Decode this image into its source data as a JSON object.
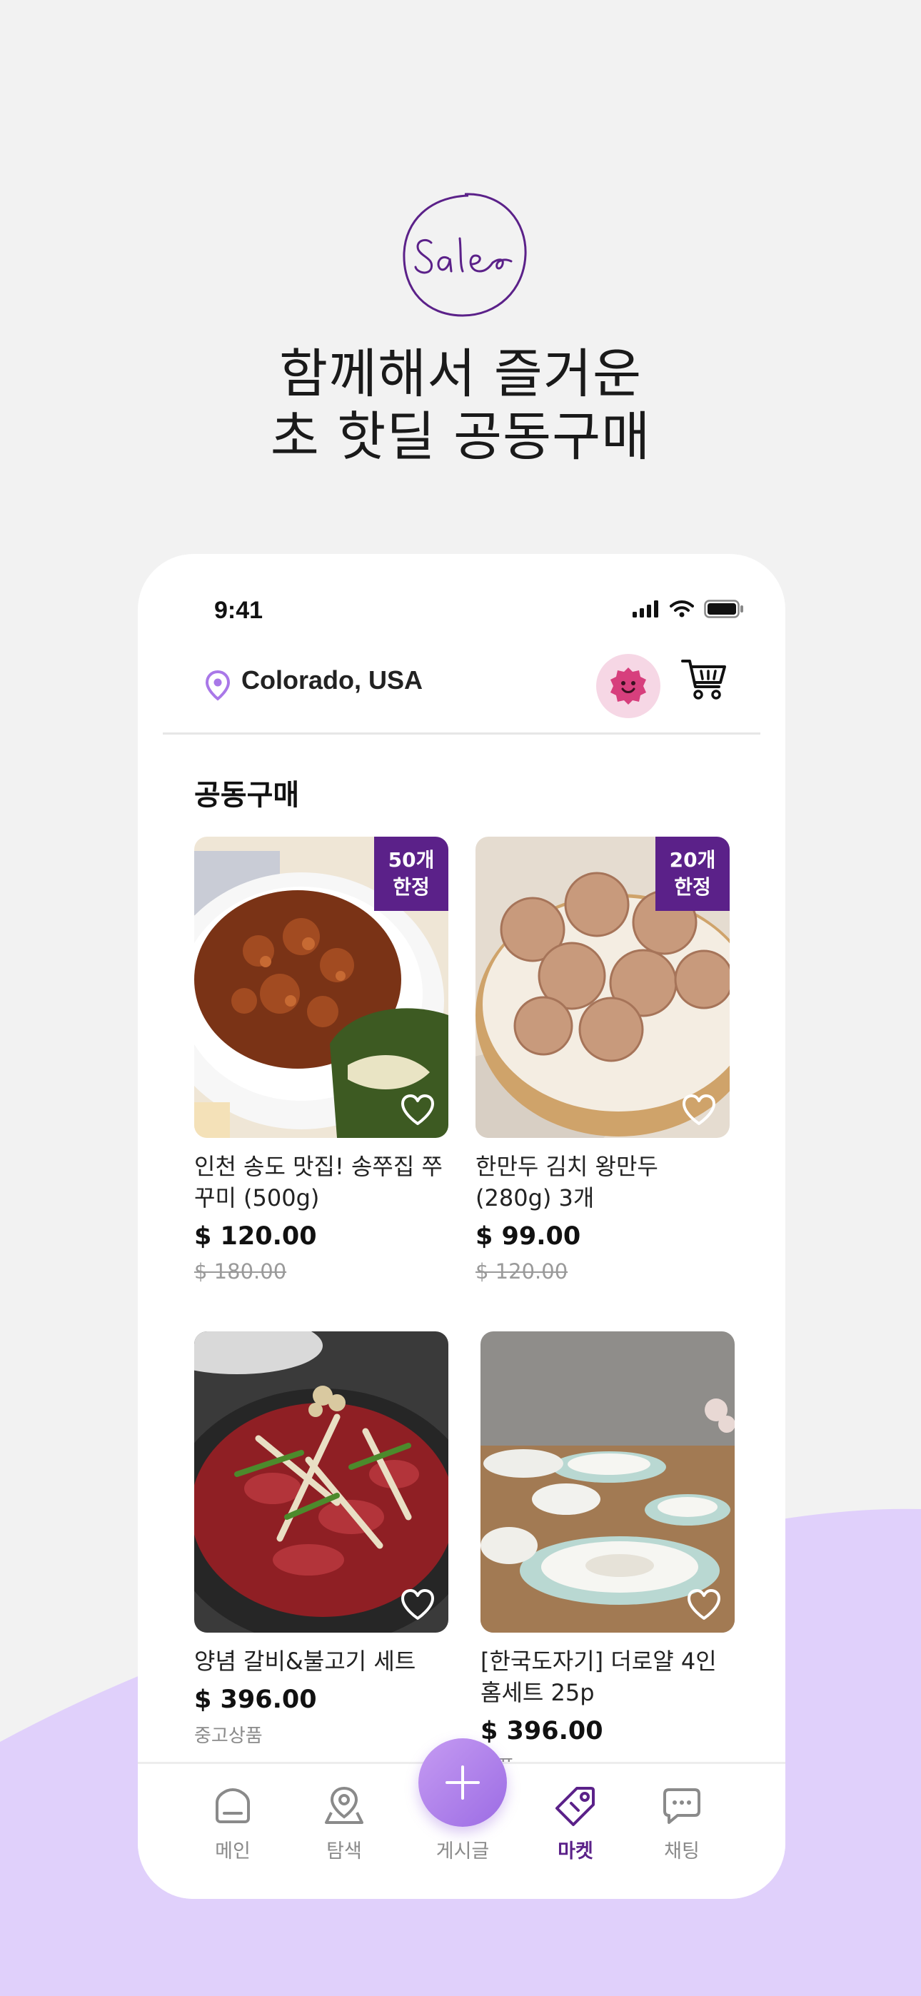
{
  "logo": {
    "text": "Sale"
  },
  "headline": {
    "line1": "함께해서 즐거운",
    "line2": "초 핫딜 공동구매"
  },
  "colors": {
    "brand": "#5b2189",
    "accent_light": "#e0d0fb",
    "fab": "#a978e8",
    "avatar_bg": "#f6d7e5"
  },
  "status_bar": {
    "time": "9:41"
  },
  "header": {
    "location": "Colorado, USA"
  },
  "section": {
    "title": "공동구매"
  },
  "products": [
    {
      "name": "인천 송도 맛집! 송쭈집 쭈꾸미 (500g)",
      "price": "$ 120.00",
      "old_price": "$ 180.00",
      "badge_l1": "50개",
      "badge_l2": "한정"
    },
    {
      "name": "한만두 김치 왕만두 (280g) 3개",
      "price": "$ 99.00",
      "old_price": "$ 120.00",
      "badge_l1": "20개",
      "badge_l2": "한정"
    },
    {
      "name": "양념 갈비&불고기 세트",
      "price": "$ 396.00",
      "condition": "중고상품"
    },
    {
      "name": "[한국도자기] 더로얄 4인 홈세트 25p",
      "price": "$ 396.00",
      "condition": "상품"
    }
  ],
  "tabbar": {
    "tabs": [
      {
        "label": "메인",
        "icon": "home-icon"
      },
      {
        "label": "탐색",
        "icon": "map-pin-icon"
      },
      {
        "label": "게시글",
        "icon": "plus-icon"
      },
      {
        "label": "마켓",
        "icon": "tag-icon"
      },
      {
        "label": "채팅",
        "icon": "chat-icon"
      }
    ],
    "active": "마켓"
  }
}
